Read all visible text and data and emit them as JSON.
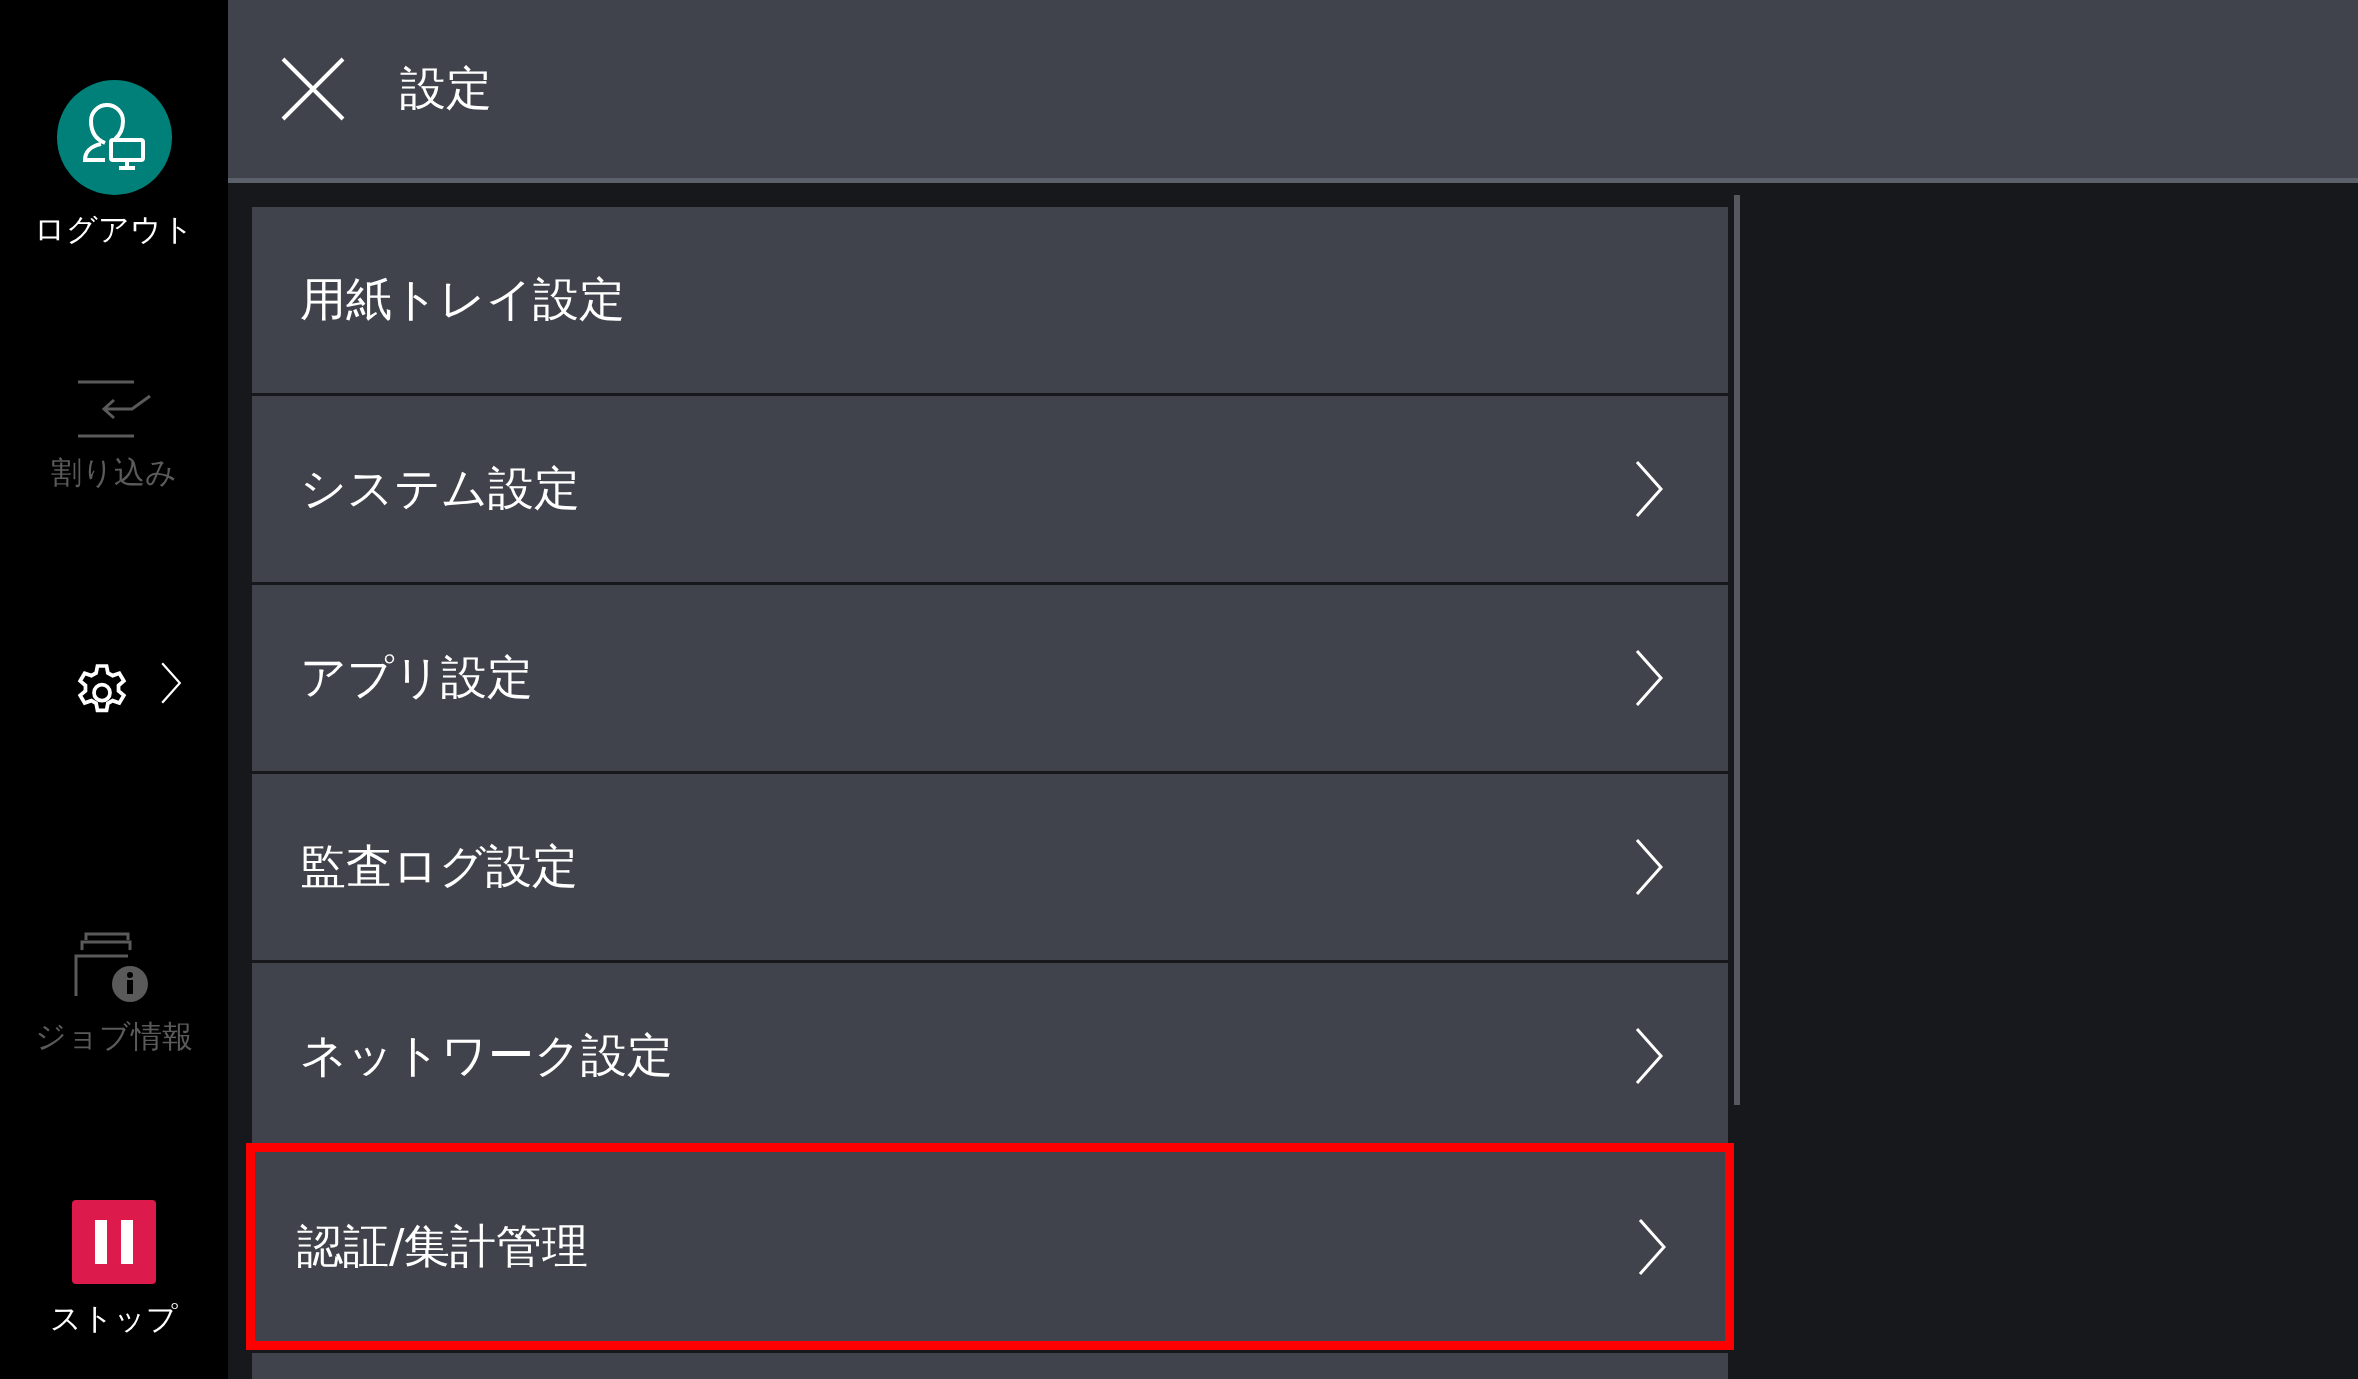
{
  "sidebar": {
    "items": [
      {
        "kind": "logout",
        "label": "ログアウト",
        "disabled": false
      },
      {
        "kind": "interrupt",
        "label": "割り込み",
        "disabled": true
      },
      {
        "kind": "settings",
        "selected": true
      },
      {
        "kind": "job_info",
        "label": "ジョブ情報",
        "disabled": true
      },
      {
        "kind": "stop",
        "label": "ストップ",
        "disabled": false
      }
    ]
  },
  "header": {
    "title": "設定"
  },
  "menu": {
    "items": [
      {
        "label": "用紙トレイ設定",
        "has_submenu": false,
        "highlighted": false
      },
      {
        "label": "システム設定",
        "has_submenu": true,
        "highlighted": false
      },
      {
        "label": "アプリ設定",
        "has_submenu": true,
        "highlighted": false
      },
      {
        "label": "監査ログ設定",
        "has_submenu": true,
        "highlighted": false
      },
      {
        "label": "ネットワーク設定",
        "has_submenu": true,
        "highlighted": false
      },
      {
        "label": "認証/集計管理",
        "has_submenu": true,
        "highlighted": true
      }
    ]
  }
}
